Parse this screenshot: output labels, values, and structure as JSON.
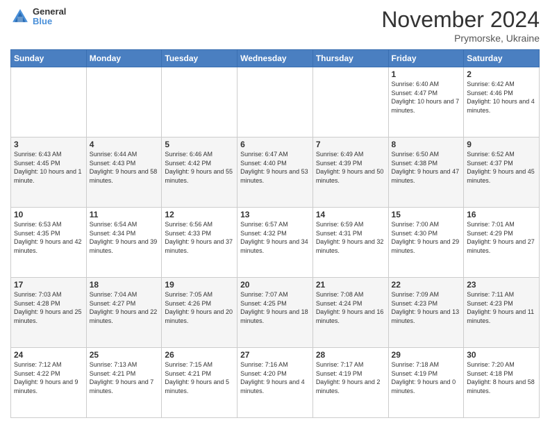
{
  "header": {
    "logo_general": "General",
    "logo_blue": "Blue",
    "month_title": "November 2024",
    "location": "Prymorske, Ukraine"
  },
  "weekdays": [
    "Sunday",
    "Monday",
    "Tuesday",
    "Wednesday",
    "Thursday",
    "Friday",
    "Saturday"
  ],
  "weeks": [
    [
      {
        "day": "",
        "info": ""
      },
      {
        "day": "",
        "info": ""
      },
      {
        "day": "",
        "info": ""
      },
      {
        "day": "",
        "info": ""
      },
      {
        "day": "",
        "info": ""
      },
      {
        "day": "1",
        "info": "Sunrise: 6:40 AM\nSunset: 4:47 PM\nDaylight: 10 hours and 7 minutes."
      },
      {
        "day": "2",
        "info": "Sunrise: 6:42 AM\nSunset: 4:46 PM\nDaylight: 10 hours and 4 minutes."
      }
    ],
    [
      {
        "day": "3",
        "info": "Sunrise: 6:43 AM\nSunset: 4:45 PM\nDaylight: 10 hours and 1 minute."
      },
      {
        "day": "4",
        "info": "Sunrise: 6:44 AM\nSunset: 4:43 PM\nDaylight: 9 hours and 58 minutes."
      },
      {
        "day": "5",
        "info": "Sunrise: 6:46 AM\nSunset: 4:42 PM\nDaylight: 9 hours and 55 minutes."
      },
      {
        "day": "6",
        "info": "Sunrise: 6:47 AM\nSunset: 4:40 PM\nDaylight: 9 hours and 53 minutes."
      },
      {
        "day": "7",
        "info": "Sunrise: 6:49 AM\nSunset: 4:39 PM\nDaylight: 9 hours and 50 minutes."
      },
      {
        "day": "8",
        "info": "Sunrise: 6:50 AM\nSunset: 4:38 PM\nDaylight: 9 hours and 47 minutes."
      },
      {
        "day": "9",
        "info": "Sunrise: 6:52 AM\nSunset: 4:37 PM\nDaylight: 9 hours and 45 minutes."
      }
    ],
    [
      {
        "day": "10",
        "info": "Sunrise: 6:53 AM\nSunset: 4:35 PM\nDaylight: 9 hours and 42 minutes."
      },
      {
        "day": "11",
        "info": "Sunrise: 6:54 AM\nSunset: 4:34 PM\nDaylight: 9 hours and 39 minutes."
      },
      {
        "day": "12",
        "info": "Sunrise: 6:56 AM\nSunset: 4:33 PM\nDaylight: 9 hours and 37 minutes."
      },
      {
        "day": "13",
        "info": "Sunrise: 6:57 AM\nSunset: 4:32 PM\nDaylight: 9 hours and 34 minutes."
      },
      {
        "day": "14",
        "info": "Sunrise: 6:59 AM\nSunset: 4:31 PM\nDaylight: 9 hours and 32 minutes."
      },
      {
        "day": "15",
        "info": "Sunrise: 7:00 AM\nSunset: 4:30 PM\nDaylight: 9 hours and 29 minutes."
      },
      {
        "day": "16",
        "info": "Sunrise: 7:01 AM\nSunset: 4:29 PM\nDaylight: 9 hours and 27 minutes."
      }
    ],
    [
      {
        "day": "17",
        "info": "Sunrise: 7:03 AM\nSunset: 4:28 PM\nDaylight: 9 hours and 25 minutes."
      },
      {
        "day": "18",
        "info": "Sunrise: 7:04 AM\nSunset: 4:27 PM\nDaylight: 9 hours and 22 minutes."
      },
      {
        "day": "19",
        "info": "Sunrise: 7:05 AM\nSunset: 4:26 PM\nDaylight: 9 hours and 20 minutes."
      },
      {
        "day": "20",
        "info": "Sunrise: 7:07 AM\nSunset: 4:25 PM\nDaylight: 9 hours and 18 minutes."
      },
      {
        "day": "21",
        "info": "Sunrise: 7:08 AM\nSunset: 4:24 PM\nDaylight: 9 hours and 16 minutes."
      },
      {
        "day": "22",
        "info": "Sunrise: 7:09 AM\nSunset: 4:23 PM\nDaylight: 9 hours and 13 minutes."
      },
      {
        "day": "23",
        "info": "Sunrise: 7:11 AM\nSunset: 4:23 PM\nDaylight: 9 hours and 11 minutes."
      }
    ],
    [
      {
        "day": "24",
        "info": "Sunrise: 7:12 AM\nSunset: 4:22 PM\nDaylight: 9 hours and 9 minutes."
      },
      {
        "day": "25",
        "info": "Sunrise: 7:13 AM\nSunset: 4:21 PM\nDaylight: 9 hours and 7 minutes."
      },
      {
        "day": "26",
        "info": "Sunrise: 7:15 AM\nSunset: 4:21 PM\nDaylight: 9 hours and 5 minutes."
      },
      {
        "day": "27",
        "info": "Sunrise: 7:16 AM\nSunset: 4:20 PM\nDaylight: 9 hours and 4 minutes."
      },
      {
        "day": "28",
        "info": "Sunrise: 7:17 AM\nSunset: 4:19 PM\nDaylight: 9 hours and 2 minutes."
      },
      {
        "day": "29",
        "info": "Sunrise: 7:18 AM\nSunset: 4:19 PM\nDaylight: 9 hours and 0 minutes."
      },
      {
        "day": "30",
        "info": "Sunrise: 7:20 AM\nSunset: 4:18 PM\nDaylight: 8 hours and 58 minutes."
      }
    ]
  ]
}
